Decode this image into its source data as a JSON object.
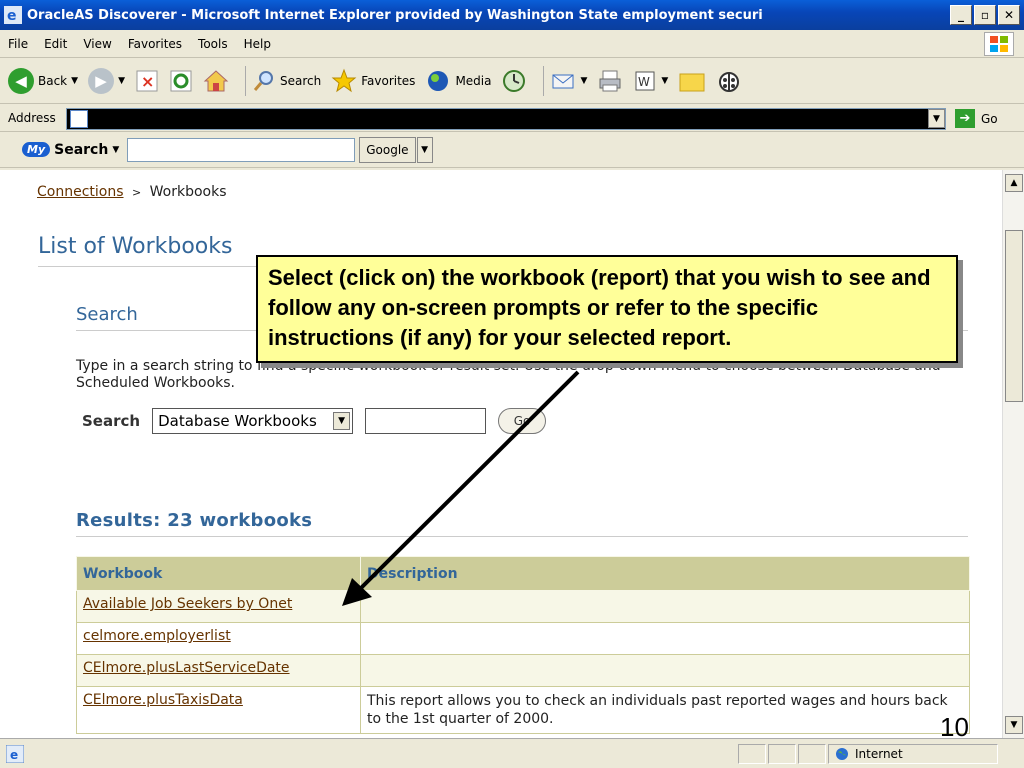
{
  "window": {
    "title": "OracleAS Discoverer - Microsoft Internet Explorer provided by Washington State employment securi"
  },
  "menu": [
    "File",
    "Edit",
    "View",
    "Favorites",
    "Tools",
    "Help"
  ],
  "toolbar": {
    "back": "Back",
    "search": "Search",
    "favorites": "Favorites",
    "media": "Media"
  },
  "address": {
    "label": "Address",
    "go": "Go"
  },
  "googlebar": {
    "mysearch": "Search",
    "my_badge": "My",
    "google_button": "Google"
  },
  "breadcrumb": {
    "link": "Connections",
    "separator": ">",
    "current": "Workbooks"
  },
  "page": {
    "title": "List of Workbooks",
    "search_heading": "Search",
    "search_description": "Type in a search string to find a specific workbook or result set. Use the drop-down menu to choose between Database and Scheduled Workbooks.",
    "search_label": "Search",
    "search_select_value": "Database Workbooks",
    "go_button": "Go",
    "results_heading": "Results: 23 workbooks"
  },
  "table": {
    "headers": [
      "Workbook",
      "Description"
    ],
    "rows": [
      {
        "workbook": "Available Job Seekers by Onet",
        "description": ""
      },
      {
        "workbook": "celmore.employerlist",
        "description": ""
      },
      {
        "workbook": "CElmore.plusLastServiceDate",
        "description": ""
      },
      {
        "workbook": "CElmore.plusTaxisData",
        "description": "This report allows you to check an individuals past reported wages and hours back to the 1st quarter of 2000."
      }
    ]
  },
  "callout": {
    "text": "Select (click on) the workbook (report) that you wish to see and follow any on-screen prompts or refer to the specific instructions (if any) for your selected report."
  },
  "status": {
    "zone": "Internet"
  },
  "slide_number": "10"
}
